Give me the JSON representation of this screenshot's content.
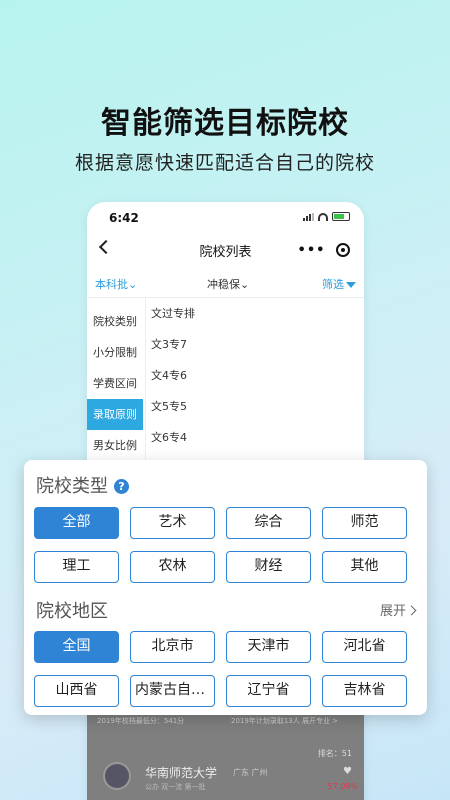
{
  "hero": {
    "title": "智能筛选目标院校",
    "subtitle": "根据意愿快速匹配适合自己的院校"
  },
  "status_bar": {
    "time": "6:42"
  },
  "nav": {
    "title": "院校列表",
    "more": "•••"
  },
  "filter_bar": {
    "batch": "本科批",
    "risk": "冲稳保",
    "filter": "筛选"
  },
  "side_menu": {
    "items": [
      "院校类别",
      "小分限制",
      "学费区间",
      "录取原则",
      "男女比例"
    ],
    "active_index": 3
  },
  "options": [
    "文过专排",
    "文3专7",
    "文4专6",
    "文5专5",
    "文6专4"
  ],
  "background_list": {
    "line_left": "2019年校档最低分：541分",
    "line_right": "2019年计划录取13人 展开专业 >",
    "rank": "排名：51",
    "university_name": "华南师范大学",
    "location": "广东 广州",
    "sub_info": "公办 双一流 第一批",
    "percent": "57.09%"
  },
  "card": {
    "type_section_title": "院校类型",
    "help_icon": "?",
    "types": [
      "全部",
      "艺术",
      "综合",
      "师范",
      "理工",
      "农林",
      "财经",
      "其他"
    ],
    "type_selected": 0,
    "region_section_title": "院校地区",
    "expand_label": "展开",
    "regions": [
      "全国",
      "北京市",
      "天津市",
      "河北省",
      "山西省",
      "内蒙古自治区",
      "辽宁省",
      "吉林省"
    ],
    "region_selected": 0
  },
  "colors": {
    "accent": "#2f84d6",
    "side_active": "#2ea8e0",
    "link": "#2e9cd8"
  }
}
